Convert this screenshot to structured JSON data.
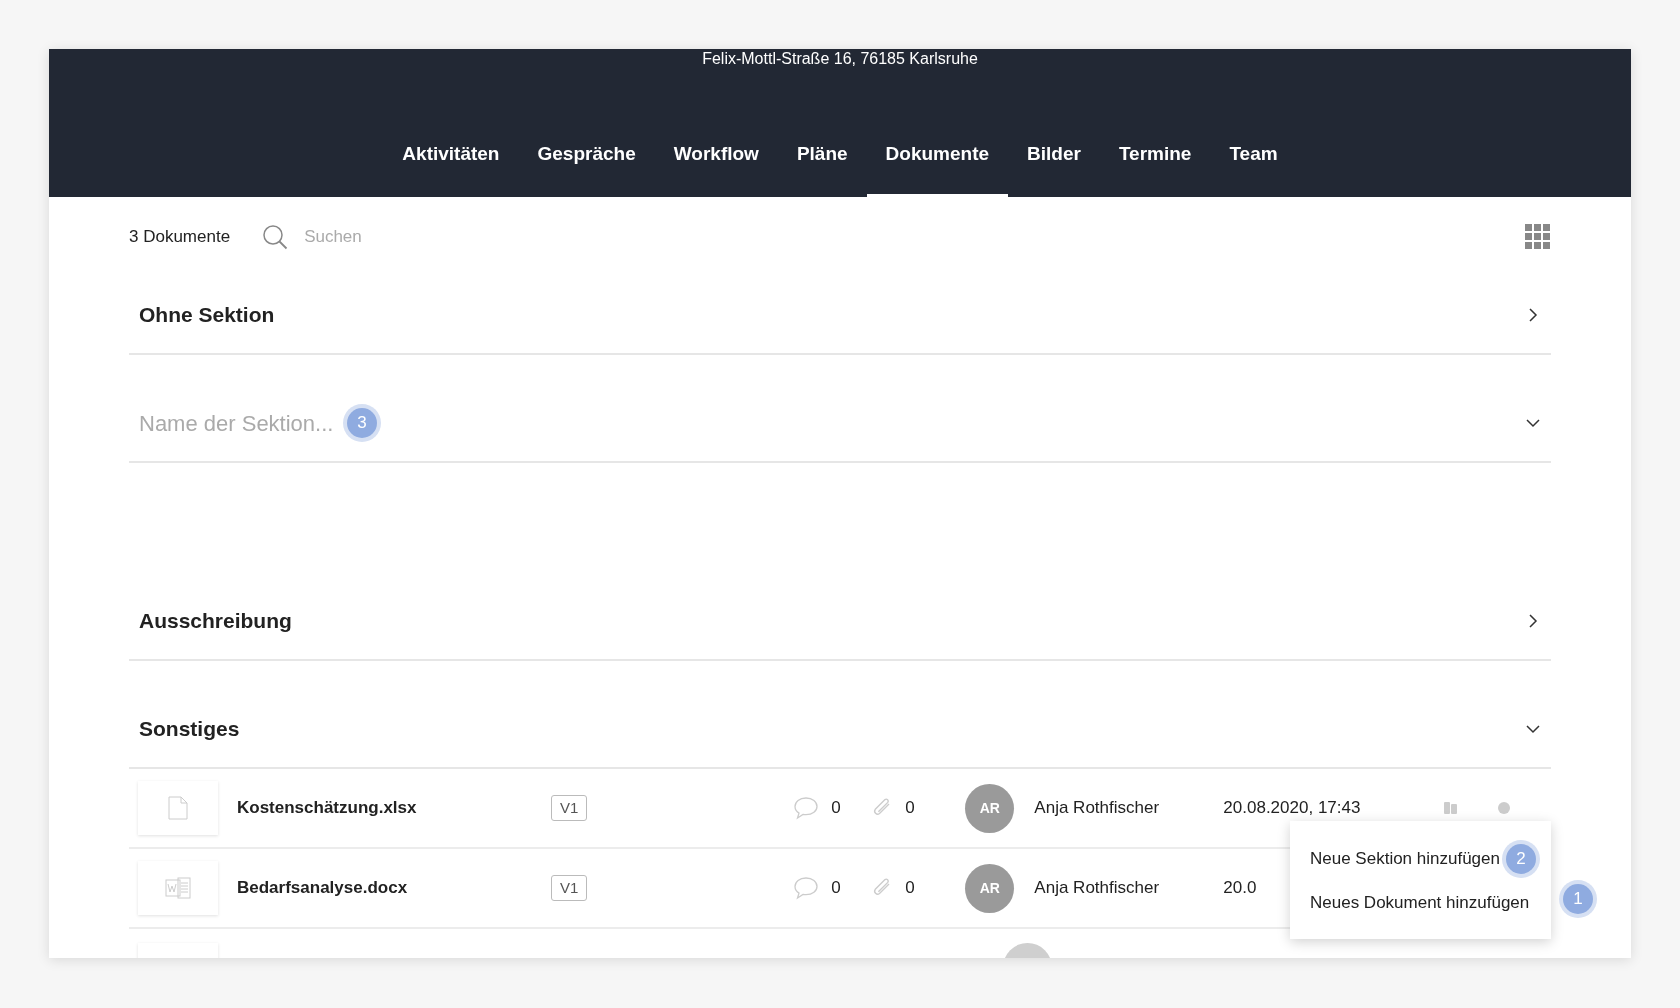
{
  "header": {
    "address": "Felix-Mottl-Straße 16, 76185 Karlsruhe",
    "tabs": [
      {
        "label": "Aktivitäten",
        "selected": false
      },
      {
        "label": "Gespräche",
        "selected": false
      },
      {
        "label": "Workflow",
        "selected": false
      },
      {
        "label": "Pläne",
        "selected": false
      },
      {
        "label": "Dokumente",
        "selected": true
      },
      {
        "label": "Bilder",
        "selected": false
      },
      {
        "label": "Termine",
        "selected": false
      },
      {
        "label": "Team",
        "selected": false
      }
    ]
  },
  "toolbar": {
    "count": "3 Dokumente",
    "search": {
      "placeholder": "Suchen"
    }
  },
  "sections": [
    {
      "kind": "title",
      "title": "Ohne Sektion",
      "expanded": false
    },
    {
      "kind": "input",
      "placeholder": "Name der Sektion...",
      "badge": "3",
      "expanded": true
    },
    {
      "kind": "title",
      "title": "Ausschreibung",
      "expanded": false
    },
    {
      "kind": "title",
      "title": "Sonstiges",
      "expanded": true,
      "documents": [
        {
          "kind": "file",
          "name": "Kostenschätzung.xlsx",
          "version": "V1",
          "comments": "0",
          "attachments": "0",
          "initials": "AR",
          "author": "Anja Rothfischer",
          "date": "20.08.2020, 17:43",
          "actions": true
        },
        {
          "kind": "word",
          "name": "Bedarfsanalyse.docx",
          "version": "V1",
          "comments": "0",
          "attachments": "0",
          "initials": "AR",
          "author": "Anja Rothfischer",
          "date": "20.0",
          "actions": false
        }
      ],
      "more_rows_cut_off": true
    }
  ],
  "menu": {
    "items": [
      {
        "label": "Neue Sektion hinzufügen",
        "badge": "2"
      },
      {
        "label": "Neues Dokument hinzufügen"
      }
    ],
    "anchor_badge": "1"
  }
}
